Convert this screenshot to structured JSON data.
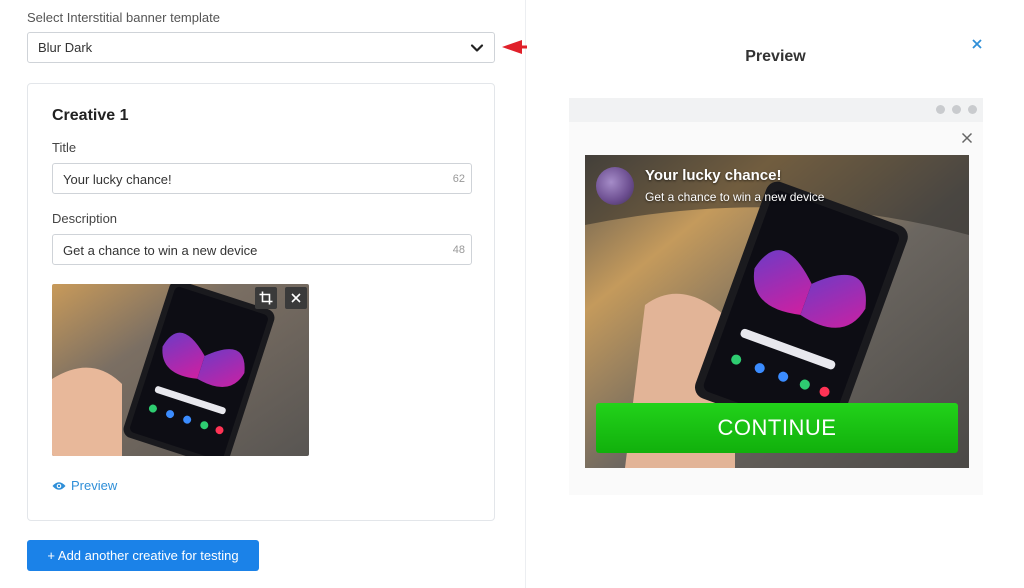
{
  "template_select": {
    "label": "Select Interstitial banner template",
    "value": "Blur Dark"
  },
  "creative": {
    "heading": "Creative 1",
    "title_label": "Title",
    "title_value": "Your lucky chance!",
    "title_remaining": "62",
    "description_label": "Description",
    "description_value": "Get a chance to win a new device",
    "description_remaining": "48",
    "preview_link": "Preview"
  },
  "add_button": "+ Add another creative for testing",
  "preview_panel": {
    "title": "Preview",
    "banner_title": "Your lucky chance!",
    "banner_description": "Get a chance to win a new device",
    "cta": "CONTINUE"
  },
  "icons": {
    "chevron": "chevron-down-icon",
    "crop": "crop-icon",
    "remove": "close-icon",
    "eye": "eye-icon",
    "annotation_arrow": "red-arrow-icon"
  },
  "colors": {
    "accent_blue": "#1b82e8",
    "link_blue": "#2f8fd8",
    "cta_green": "#1bc313",
    "annotation_red": "#e0202a"
  }
}
